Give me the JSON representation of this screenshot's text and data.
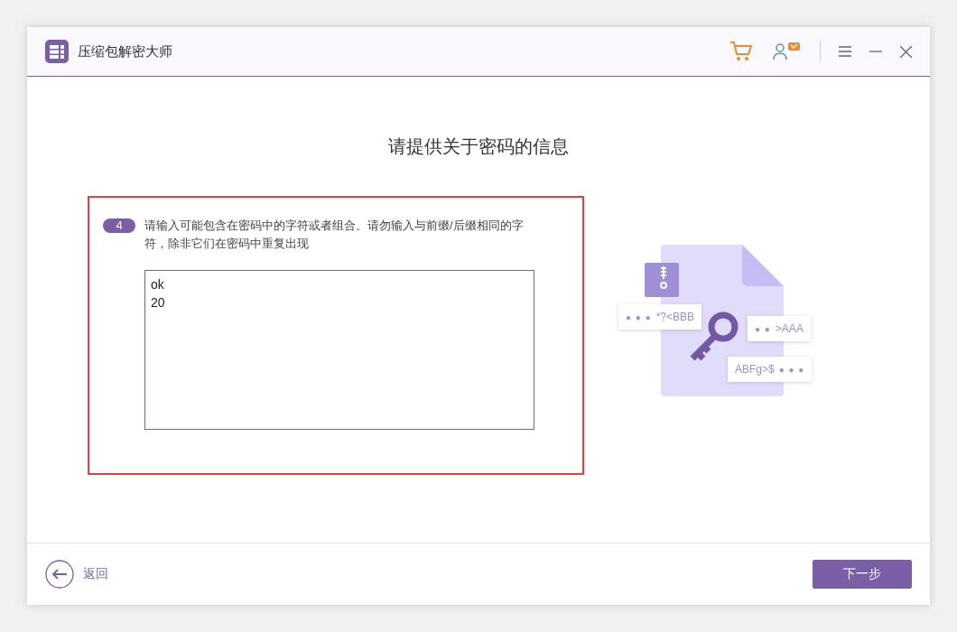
{
  "window": {
    "title": "压缩包解密大师"
  },
  "heading": "请提供关于密码的信息",
  "step": {
    "number": "4",
    "instruction": "请输入可能包含在密码中的字符或者组合。请勿输入与前缀/后缀相同的字符，除非它们在密码中重复出现",
    "value": "ok\n20"
  },
  "illustration": {
    "chips": [
      {
        "text": "*?<BBB",
        "kind": "dots-first",
        "dots": "● ● ●"
      },
      {
        "text": ">AAA",
        "kind": "dots-first",
        "dots": "● ●"
      },
      {
        "text": "ABFg>$",
        "kind": "dots-last",
        "dots": "● ● ●"
      }
    ]
  },
  "footer": {
    "back": "返回",
    "next": "下一步"
  }
}
